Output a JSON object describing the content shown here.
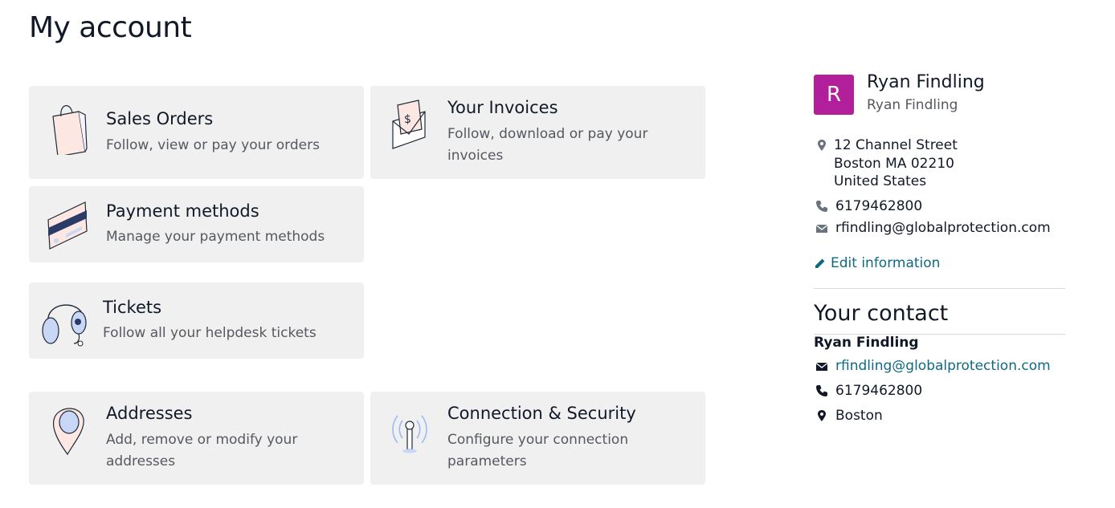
{
  "page": {
    "title": "My account"
  },
  "cards": {
    "sales_orders": {
      "title": "Sales Orders",
      "desc": "Follow, view or pay your orders"
    },
    "invoices": {
      "title": "Your Invoices",
      "desc": "Follow, download or pay your invoices"
    },
    "payment": {
      "title": "Payment methods",
      "desc": "Manage your payment methods"
    },
    "tickets": {
      "title": "Tickets",
      "desc": "Follow all your helpdesk tickets"
    },
    "addresses": {
      "title": "Addresses",
      "desc": "Add, remove or modify your addresses"
    },
    "security": {
      "title": "Connection & Security",
      "desc": "Configure your connection parameters"
    }
  },
  "profile": {
    "avatar_letter": "R",
    "avatar_color": "#b21f9b",
    "name": "Ryan Findling",
    "company": "Ryan Findling",
    "address_line1": "12 Channel Street",
    "address_line2": "Boston MA 02210",
    "address_line3": "United States",
    "phone": "6179462800",
    "email": "rfindling@globalprotection.com",
    "edit_label": "Edit information"
  },
  "contact": {
    "heading": "Your contact",
    "name": "Ryan Findling",
    "email": "rfindling@globalprotection.com",
    "phone": "6179462800",
    "city": "Boston"
  },
  "colors": {
    "link": "#0e6a80",
    "card_bg": "#f0f0f0",
    "avatar": "#b21f9b"
  }
}
